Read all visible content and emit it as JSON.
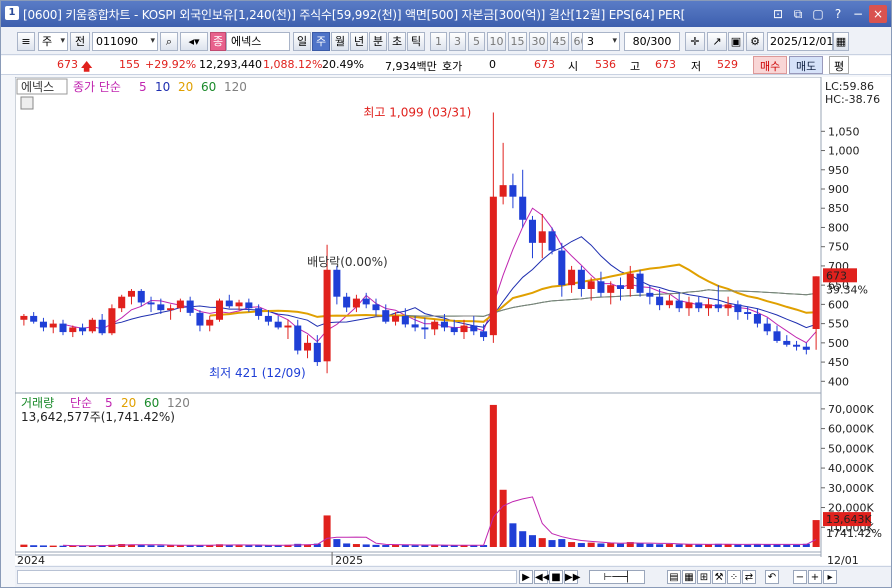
{
  "window": {
    "app_number": "1",
    "title": "[0600] 키움종합차트 - KOSPI 외국인보유[1,240(천)] 주식수[59,992(천)] 액면[500] 자본금[300(억)] 결산[12월] EPS[64] PER[",
    "buttons": [
      "⊡",
      "⧉",
      "▢",
      "?",
      "−",
      "×"
    ]
  },
  "toolbar": {
    "market": "주",
    "all_label": "전",
    "code": "011090",
    "stock_name": "에넥스",
    "period_tabs": [
      "일",
      "주",
      "월",
      "년",
      "분",
      "초",
      "틱"
    ],
    "active_period": "주",
    "interval_buttons": [
      "1",
      "3",
      "5",
      "10",
      "15",
      "30",
      "45",
      "60"
    ],
    "interval_select": "3",
    "count": "80",
    "count_total": "/300",
    "date": "2025/12/01"
  },
  "pricebar": {
    "price": "673",
    "change": "155",
    "change_pct": "+29.92%",
    "volume": "12,293,440",
    "volume_pct": "1,088.12%",
    "turnover": "20.49%",
    "amount": "7,934백만",
    "quote_label": "호가",
    "quote_val": "0",
    "quote_price": "673",
    "open_label": "시",
    "open": "536",
    "high_label": "고",
    "high": "673",
    "low_label": "저",
    "low": "529",
    "buy": "매수",
    "sell": "매도",
    "even": "평"
  },
  "legend_top": {
    "name": "에넥스",
    "label": "종가 단순",
    "ma": [
      "5",
      "10",
      "20",
      "60",
      "120"
    ],
    "ma_colors": [
      "#c026b0",
      "#1f2fb0",
      "#e0a000",
      "#1a8a2a",
      "#808080"
    ]
  },
  "legend_bottom": {
    "name": "거래량",
    "label": "단순",
    "ma": [
      "5",
      "20",
      "60",
      "120"
    ],
    "volume_text": "13,642,577주(1,741.42%)"
  },
  "annotations": {
    "high": "최고 1,099 (03/31)",
    "low": "최저 421 (12/09)",
    "dividend": "배당락(0.00%)",
    "lc": "LC:59.86",
    "hc": "HC:-38.76",
    "cur_price": "673",
    "cur_pct": "39.34%",
    "cur_vol": "13,643K",
    "cur_vol_pct": "1741.42%"
  },
  "chart_data": [
    {
      "type": "candlestick",
      "title": "",
      "ylim": [
        380,
        1160
      ],
      "y_ticks": [
        "400",
        "450",
        "500",
        "550",
        "600",
        "650",
        "700",
        "750",
        "800",
        "850",
        "900",
        "950",
        "1,000",
        "1,050"
      ],
      "x_labels": [
        "2024",
        "2025",
        "12/01"
      ],
      "candles": [
        [
          560,
          575,
          545,
          570
        ],
        [
          570,
          580,
          550,
          555
        ],
        [
          555,
          565,
          530,
          540
        ],
        [
          540,
          560,
          525,
          550
        ],
        [
          550,
          560,
          520,
          528
        ],
        [
          528,
          545,
          515,
          540
        ],
        [
          540,
          550,
          520,
          530
        ],
        [
          530,
          565,
          525,
          560
        ],
        [
          560,
          575,
          520,
          525
        ],
        [
          525,
          600,
          520,
          590
        ],
        [
          590,
          625,
          580,
          620
        ],
        [
          620,
          640,
          600,
          635
        ],
        [
          635,
          640,
          595,
          605
        ],
        [
          605,
          620,
          580,
          600
        ],
        [
          600,
          615,
          575,
          585
        ],
        [
          585,
          600,
          560,
          590
        ],
        [
          590,
          615,
          580,
          610
        ],
        [
          610,
          620,
          570,
          578
        ],
        [
          578,
          585,
          530,
          545
        ],
        [
          545,
          570,
          530,
          560
        ],
        [
          560,
          615,
          555,
          610
        ],
        [
          610,
          625,
          590,
          595
        ],
        [
          595,
          612,
          585,
          605
        ],
        [
          605,
          615,
          580,
          590
        ],
        [
          590,
          600,
          560,
          570
        ],
        [
          570,
          585,
          545,
          555
        ],
        [
          555,
          570,
          535,
          540
        ],
        [
          540,
          560,
          510,
          545
        ],
        [
          545,
          560,
          470,
          480
        ],
        [
          480,
          520,
          460,
          500
        ],
        [
          500,
          520,
          440,
          450
        ],
        [
          452,
          755,
          421,
          690
        ],
        [
          690,
          700,
          600,
          620
        ],
        [
          620,
          630,
          580,
          592
        ],
        [
          592,
          625,
          580,
          615
        ],
        [
          615,
          630,
          590,
          600
        ],
        [
          600,
          615,
          570,
          585
        ],
        [
          585,
          600,
          550,
          555
        ],
        [
          555,
          580,
          545,
          570
        ],
        [
          570,
          590,
          540,
          548
        ],
        [
          548,
          570,
          530,
          540
        ],
        [
          540,
          565,
          510,
          535
        ],
        [
          535,
          560,
          520,
          555
        ],
        [
          555,
          575,
          530,
          540
        ],
        [
          540,
          560,
          520,
          528
        ],
        [
          528,
          560,
          510,
          545
        ],
        [
          545,
          570,
          520,
          530
        ],
        [
          530,
          548,
          505,
          515
        ],
        [
          520,
          1099,
          500,
          880
        ],
        [
          880,
          1020,
          860,
          910
        ],
        [
          910,
          940,
          850,
          880
        ],
        [
          880,
          950,
          800,
          820
        ],
        [
          820,
          830,
          720,
          760
        ],
        [
          760,
          835,
          720,
          790
        ],
        [
          790,
          800,
          730,
          740
        ],
        [
          740,
          760,
          620,
          650
        ],
        [
          650,
          700,
          630,
          690
        ],
        [
          690,
          700,
          620,
          640
        ],
        [
          640,
          670,
          610,
          660
        ],
        [
          660,
          685,
          620,
          630
        ],
        [
          630,
          660,
          600,
          650
        ],
        [
          650,
          670,
          610,
          640
        ],
        [
          640,
          700,
          620,
          680
        ],
        [
          680,
          690,
          620,
          630
        ],
        [
          630,
          650,
          600,
          620
        ],
        [
          620,
          640,
          585,
          598
        ],
        [
          598,
          625,
          590,
          610
        ],
        [
          610,
          630,
          580,
          590
        ],
        [
          590,
          620,
          570,
          605
        ],
        [
          605,
          620,
          580,
          590
        ],
        [
          590,
          615,
          570,
          600
        ],
        [
          600,
          650,
          580,
          590
        ],
        [
          590,
          620,
          570,
          600
        ],
        [
          600,
          610,
          560,
          580
        ],
        [
          580,
          595,
          560,
          575
        ],
        [
          575,
          590,
          540,
          550
        ],
        [
          550,
          565,
          520,
          530
        ],
        [
          530,
          545,
          500,
          505
        ],
        [
          505,
          520,
          490,
          495
        ],
        [
          495,
          505,
          480,
          490
        ],
        [
          490,
          500,
          470,
          482
        ],
        [
          536,
          673,
          482,
          673
        ]
      ]
    },
    {
      "type": "bar",
      "title": "",
      "ylim": [
        0,
        75000
      ],
      "y_ticks": [
        "10,000K",
        "20,000K",
        "30,000K",
        "40,000K",
        "50,000K",
        "60,000K",
        "70,000K"
      ],
      "volume_k": [
        1200,
        900,
        800,
        700,
        650,
        600,
        580,
        700,
        900,
        1100,
        1500,
        1300,
        1000,
        900,
        800,
        850,
        900,
        800,
        950,
        1000,
        1400,
        1000,
        900,
        850,
        800,
        900,
        950,
        1100,
        1600,
        1300,
        1700,
        16000,
        4000,
        1800,
        1500,
        1300,
        1100,
        1000,
        1200,
        1000,
        900,
        950,
        1000,
        900,
        850,
        900,
        950,
        1000,
        72000,
        29000,
        12000,
        8000,
        6000,
        4500,
        3500,
        4000,
        2500,
        2000,
        2200,
        1800,
        2000,
        1700,
        2500,
        2000,
        1600,
        1400,
        1500,
        1300,
        1400,
        1200,
        1300,
        1600,
        1400,
        1200,
        1100,
        1500,
        1300,
        1500,
        1200,
        1100,
        1600,
        13643
      ]
    }
  ]
}
